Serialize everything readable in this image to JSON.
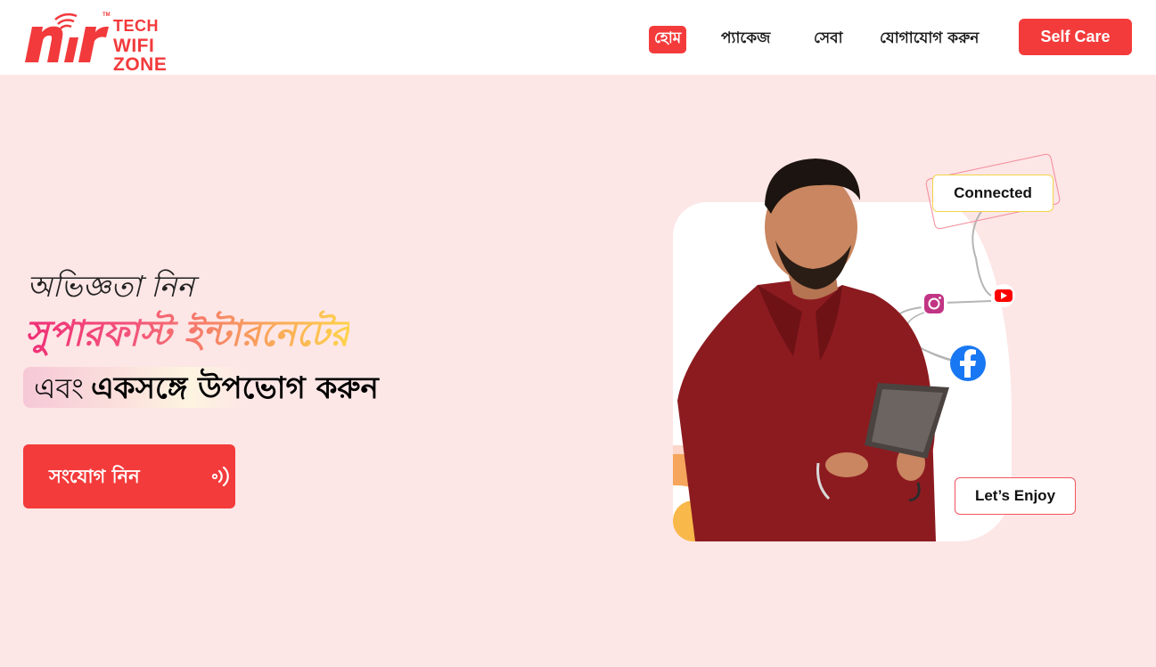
{
  "brand": {
    "logo_mark": "nr",
    "logo_line1": "TECH",
    "logo_line2": "WIFI ZONE",
    "trademark": "TM",
    "accent": "#f43b3b"
  },
  "nav": {
    "items": [
      {
        "label": "হোম",
        "active": true
      },
      {
        "label": "প্যাকেজ",
        "active": false
      },
      {
        "label": "সেবা",
        "active": false
      },
      {
        "label": "যোগাযোগ করুন",
        "active": false
      }
    ],
    "self_care_label": "Self Care"
  },
  "hero": {
    "line1": "অভিজ্ঞতা নিন",
    "line2": "সুপারফাস্ট ইন্টারনেটের",
    "line3_part1": "এবং",
    "line3_part2": "একসঙ্গে উপভোগ করুন",
    "cta_label": "সংযোগ নিন",
    "cta_icon": "wifi-signal-icon"
  },
  "illustration": {
    "tag_connected": "Connected",
    "tag_enjoy": "Let’s Enjoy",
    "icons": [
      "instagram-icon",
      "youtube-icon",
      "facebook-icon"
    ]
  }
}
